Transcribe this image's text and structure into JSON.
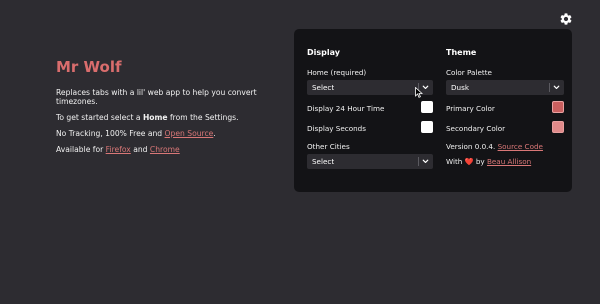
{
  "intro": {
    "title": "Mr Wolf",
    "line1": "Replaces tabs with a lil' web app to help you convert timezones.",
    "line2_pre": "To get started select a ",
    "line2_bold": "Home",
    "line2_post": " from the Settings.",
    "line3_pre": "No Tracking, 100% Free and ",
    "line3_link": "Open Source",
    "line3_post": ".",
    "line4_pre": "Available for ",
    "line4_link1": "Firefox",
    "line4_mid": " and ",
    "line4_link2": "Chrome"
  },
  "settings": {
    "display_heading": "Display",
    "home_label": "Home (required)",
    "home_value": "Select",
    "display24_label": "Display 24 Hour Time",
    "display24_checked": false,
    "display_seconds_label": "Display Seconds",
    "display_seconds_checked": false,
    "other_cities_label": "Other Cities",
    "other_cities_value": "Select",
    "theme_heading": "Theme",
    "palette_label": "Color Palette",
    "palette_value": "Dusk",
    "primary_label": "Primary Color",
    "primary_color": "#c95f5f",
    "secondary_label": "Secondary Color",
    "secondary_color": "#e08a8a",
    "version_pre": "Version 0.0.4. ",
    "version_link": "Source Code",
    "with_pre": "With ",
    "heart": "❤️",
    "with_mid": " by ",
    "author_link": "Beau Allison"
  },
  "icons": {
    "gear": "gear-icon",
    "chevron": "chevron-down-icon",
    "heart": "heart-icon"
  },
  "colors": {
    "background": "#2d2c31",
    "panel": "#131316",
    "accent": "#d96d6d"
  }
}
